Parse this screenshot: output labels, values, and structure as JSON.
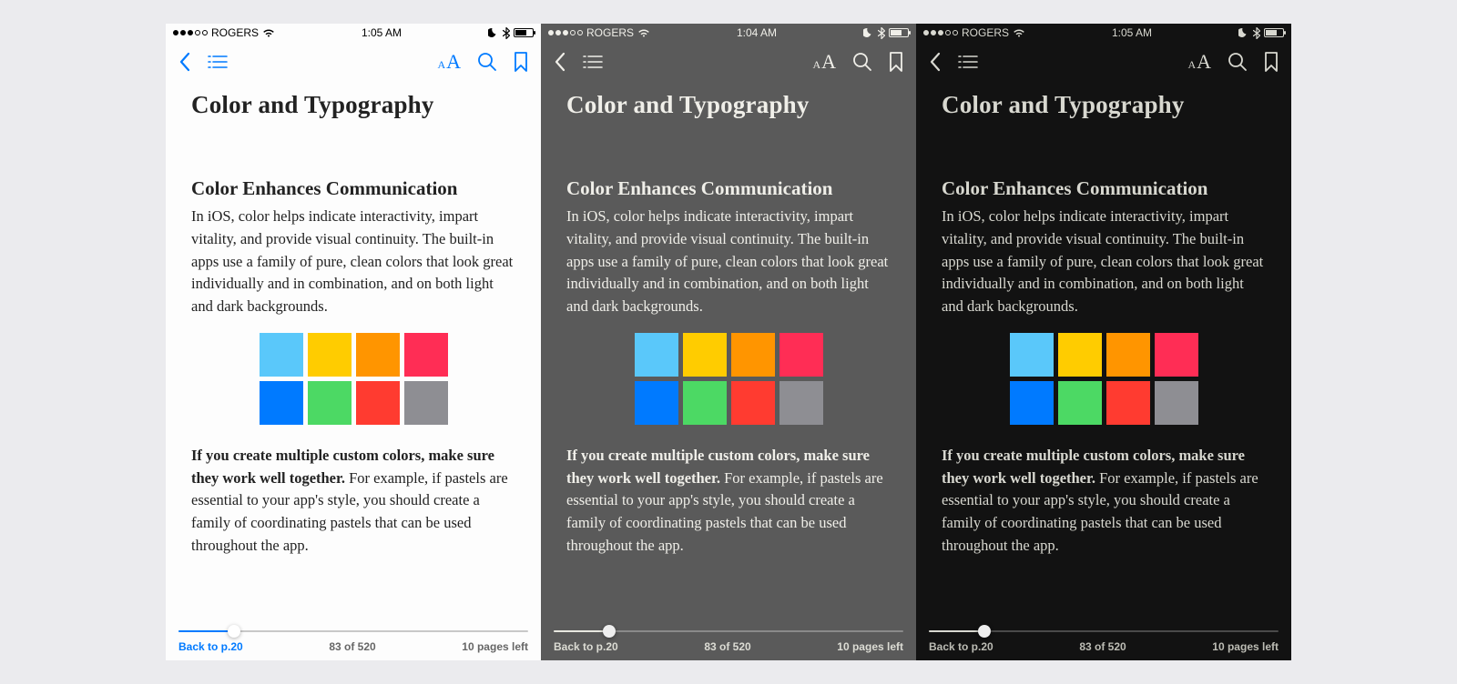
{
  "screens": [
    {
      "theme": "theme-light",
      "time": "1:05 AM",
      "carrier": "ROGERS",
      "signal_filled": 3,
      "back_link": "Back to p.20",
      "page_counter": "83 of 520",
      "pages_left": "10 pages left",
      "slider_percent": 16
    },
    {
      "theme": "theme-sepia",
      "time": "1:04 AM",
      "carrier": "ROGERS",
      "signal_filled": 3,
      "back_link": "Back to p.20",
      "page_counter": "83 of 520",
      "pages_left": "10 pages left",
      "slider_percent": 16
    },
    {
      "theme": "theme-night",
      "time": "1:05 AM",
      "carrier": "ROGERS",
      "signal_filled": 3,
      "back_link": "Back to p.20",
      "page_counter": "83 of 520",
      "pages_left": "10 pages left",
      "slider_percent": 16
    }
  ],
  "content": {
    "chapter_title": "Color and Typography",
    "section_title": "Color Enhances Communication",
    "paragraph1": "In iOS, color helps indicate interactivity, impart vitality, and provide visual continuity. The built-in apps use a family of pure, clean colors that look great individually and in combination, and on both light and dark backgrounds.",
    "paragraph2_bold": "If you create multiple custom colors, make sure they work well together.",
    "paragraph2_rest": " For example, if pastels are essential to your app's style, you should create a family of coordinating pastels that can be used throughout the app.",
    "swatches": [
      "#5ac8fa",
      "#ffcc00",
      "#ff9500",
      "#ff2d55",
      "#007aff",
      "#4cd964",
      "#ff3b30",
      "#8e8e93"
    ]
  }
}
